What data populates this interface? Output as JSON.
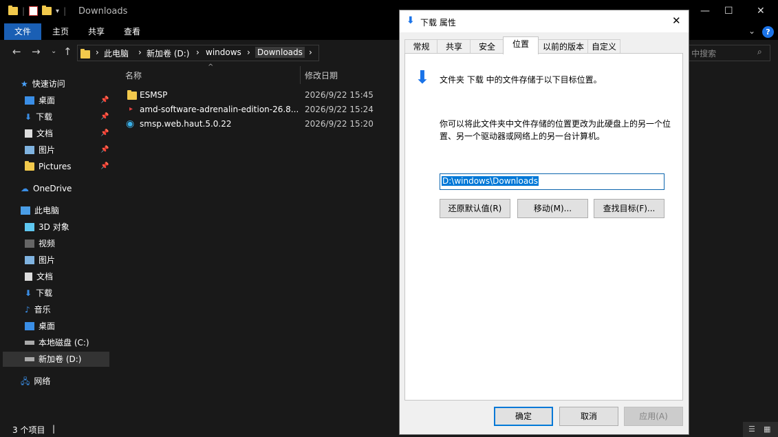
{
  "explorer": {
    "title": "Downloads",
    "ribbon_tabs": [
      "文件",
      "主页",
      "共享",
      "查看"
    ],
    "breadcrumb": [
      "此电脑",
      "新加卷 (D:)",
      "windows",
      "Downloads"
    ],
    "search_placeholder": "s 中搜索",
    "columns": {
      "name": "名称",
      "date": "修改日期"
    },
    "files": [
      {
        "name": "ESMSP",
        "date": "2026/9/22 15:45",
        "icon": "folder-icon"
      },
      {
        "name": "amd-software-adrenalin-edition-26.8....",
        "date": "2026/9/22 15:24",
        "icon": "installer-icon"
      },
      {
        "name": "smsp.web.haut.5.0.22",
        "date": "2026/9/22 15:20",
        "icon": "edge-icon"
      }
    ],
    "nav": {
      "quick_access": "快速访问",
      "quick_items": [
        "桌面",
        "下载",
        "文档",
        "图片",
        "Pictures"
      ],
      "onedrive": "OneDrive",
      "this_pc": "此电脑",
      "pc_items": [
        "3D 对象",
        "视频",
        "图片",
        "文档",
        "下载",
        "音乐",
        "桌面",
        "本地磁盘 (C:)",
        "新加卷 (D:)"
      ],
      "network": "网络"
    },
    "status": "3 个项目"
  },
  "dialog": {
    "title": "下载 属性",
    "tabs": [
      "常规",
      "共享",
      "安全",
      "位置",
      "以前的版本",
      "自定义"
    ],
    "active_tab": "位置",
    "header": "文件夹 下载 中的文件存储于以下目标位置。",
    "description": "你可以将此文件夹中文件存储的位置更改为此硬盘上的另一个位置、另一个驱动器或网络上的另一台计算机。",
    "path": "D:\\windows\\Downloads",
    "restore_default": "还原默认值(R)",
    "move": "移动(M)...",
    "find_target": "查找目标(F)...",
    "ok": "确定",
    "cancel": "取消",
    "apply": "应用(A)"
  },
  "colors": {
    "accent": "#0078d7",
    "file_tab": "#1a5fb4",
    "folder": "#f2c94c"
  }
}
